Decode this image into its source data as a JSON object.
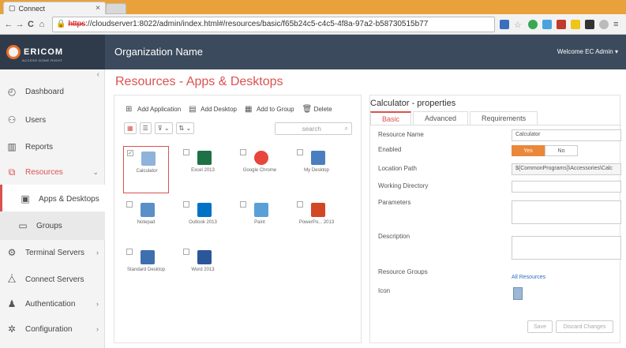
{
  "browser": {
    "tab_title": "Connect",
    "tab_close": "×",
    "url_proto": "https",
    "url_rest": "://cloudserver1:8022/admin/index.html#/resources/basic/f65b24c5-c4c5-4f8a-97a2-b58730515b77",
    "nav_back": "←",
    "nav_forward": "→",
    "nav_reload": "C",
    "nav_home": "⌂"
  },
  "header": {
    "logo_text": "ERICOM",
    "logo_tagline": "ACCESS DONE RIGHT",
    "org_name": "Organization Name",
    "welcome": "Welcome EC Admin ▾"
  },
  "sidebar": {
    "items": [
      {
        "label": "Dashboard",
        "icon": "dashboard-icon"
      },
      {
        "label": "Users",
        "icon": "users-icon"
      },
      {
        "label": "Reports",
        "icon": "reports-icon"
      },
      {
        "label": "Resources",
        "icon": "resources-icon"
      },
      {
        "label": "Apps & Desktops",
        "icon": "apps-desktops-icon"
      },
      {
        "label": "Groups",
        "icon": "groups-icon"
      },
      {
        "label": "Terminal Servers",
        "icon": "terminal-servers-icon"
      },
      {
        "label": "Connect Servers",
        "icon": "connect-servers-icon"
      },
      {
        "label": "Authentication",
        "icon": "authentication-icon"
      },
      {
        "label": "Configuration",
        "icon": "configuration-icon"
      }
    ]
  },
  "main": {
    "title": "Resources - Apps & Desktops",
    "toolbar": {
      "add_application": "Add Application",
      "add_desktop": "Add Desktop",
      "add_to_group": "Add to Group",
      "delete": "Delete"
    },
    "search_placeholder": "search",
    "tiles": [
      {
        "label": "Calculator",
        "color": "#8fb3d9",
        "checked": true
      },
      {
        "label": "Excel 2013",
        "color": "#1e7145",
        "checked": false
      },
      {
        "label": "Google Chrome",
        "color": "#e8453c",
        "checked": false
      },
      {
        "label": "My Desktop",
        "color": "#4a7fbf",
        "checked": false
      },
      {
        "label": "Notepad",
        "color": "#5b8fc7",
        "checked": false
      },
      {
        "label": "Outlook 2013",
        "color": "#0072c6",
        "checked": false
      },
      {
        "label": "Paint",
        "color": "#5aa0d8",
        "checked": false
      },
      {
        "label": "PowerPo... 2013",
        "color": "#d24726",
        "checked": false
      },
      {
        "label": "Standard Desktop",
        "color": "#3f6fae",
        "checked": false
      },
      {
        "label": "Word 2013",
        "color": "#2b579a",
        "checked": false
      }
    ]
  },
  "properties": {
    "title": "Calculator - properties",
    "tabs": [
      "Basic",
      "Advanced",
      "Requirements"
    ],
    "fields": {
      "resource_name_label": "Resource Name",
      "resource_name_value": "Calculator",
      "enabled_label": "Enabled",
      "yes": "Yes",
      "no": "No",
      "location_label": "Location Path",
      "location_value": "${CommonPrograms}\\Accessories\\Calc",
      "working_dir_label": "Working Directory",
      "parameters_label": "Parameters",
      "description_label": "Description",
      "resource_groups_label": "Resource Groups",
      "resource_groups_value": "All Resources",
      "icon_label": "Icon"
    },
    "save": "Save",
    "discard": "Discard Changes"
  },
  "colors": {
    "accent": "#d9534f",
    "header": "#3b4a5c",
    "orange": "#e9873a"
  }
}
